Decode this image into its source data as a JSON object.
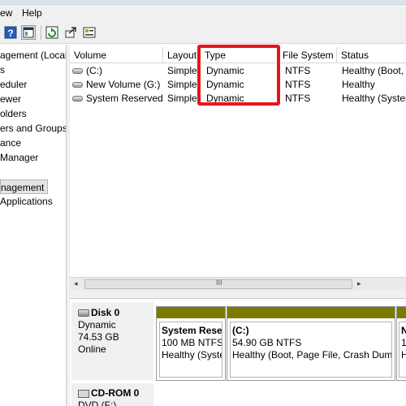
{
  "menu": {
    "view": "ew",
    "help": "Help"
  },
  "toolbar": {
    "icons": [
      "help-book-icon",
      "show-hide-icon",
      "refresh-icon",
      "rescan-icon",
      "properties-icon"
    ]
  },
  "tree": {
    "items": [
      {
        "label": "agement (Local"
      },
      {
        "label": "s"
      },
      {
        "label": "eduler"
      },
      {
        "label": "ewer"
      },
      {
        "label": "olders"
      },
      {
        "label": "ers and Groups"
      },
      {
        "label": "ance"
      },
      {
        "label": "Manager"
      },
      {
        "label": "nagement"
      },
      {
        "label": " Applications"
      }
    ]
  },
  "volume_list": {
    "columns": [
      "Volume",
      "Layout",
      "Type",
      "File System",
      "Status"
    ],
    "rows": [
      {
        "volume": "(C:)",
        "layout": "Simple",
        "type": "Dynamic",
        "fs": "NTFS",
        "status": "Healthy (Boot,"
      },
      {
        "volume": "New Volume (G:)",
        "layout": "Simple",
        "type": "Dynamic",
        "fs": "NTFS",
        "status": "Healthy"
      },
      {
        "volume": "System Reserved",
        "layout": "Simple",
        "type": "Dynamic",
        "fs": "NTFS",
        "status": "Healthy (System"
      }
    ]
  },
  "scrollbar": {
    "left_arrow": "◂",
    "right_arrow": "▸",
    "grip": "III"
  },
  "disks": {
    "disk0": {
      "name": "Disk 0",
      "type": "Dynamic",
      "size": "74.53 GB",
      "status": "Online"
    },
    "partitions": [
      {
        "title": "System Rese",
        "size": "100 MB NTFS",
        "status": "Healthy (Syste"
      },
      {
        "title": "(C:)",
        "size": "54.90 GB NTFS",
        "status": "Healthy (Boot, Page File, Crash Dump"
      },
      {
        "title": "N",
        "size": "1",
        "status": "H"
      }
    ],
    "cdrom": {
      "name": "CD-ROM 0",
      "type": "DVD (F:)"
    }
  },
  "colors": {
    "partition_bar": "#7a7a00",
    "highlight": "#e8141c"
  }
}
